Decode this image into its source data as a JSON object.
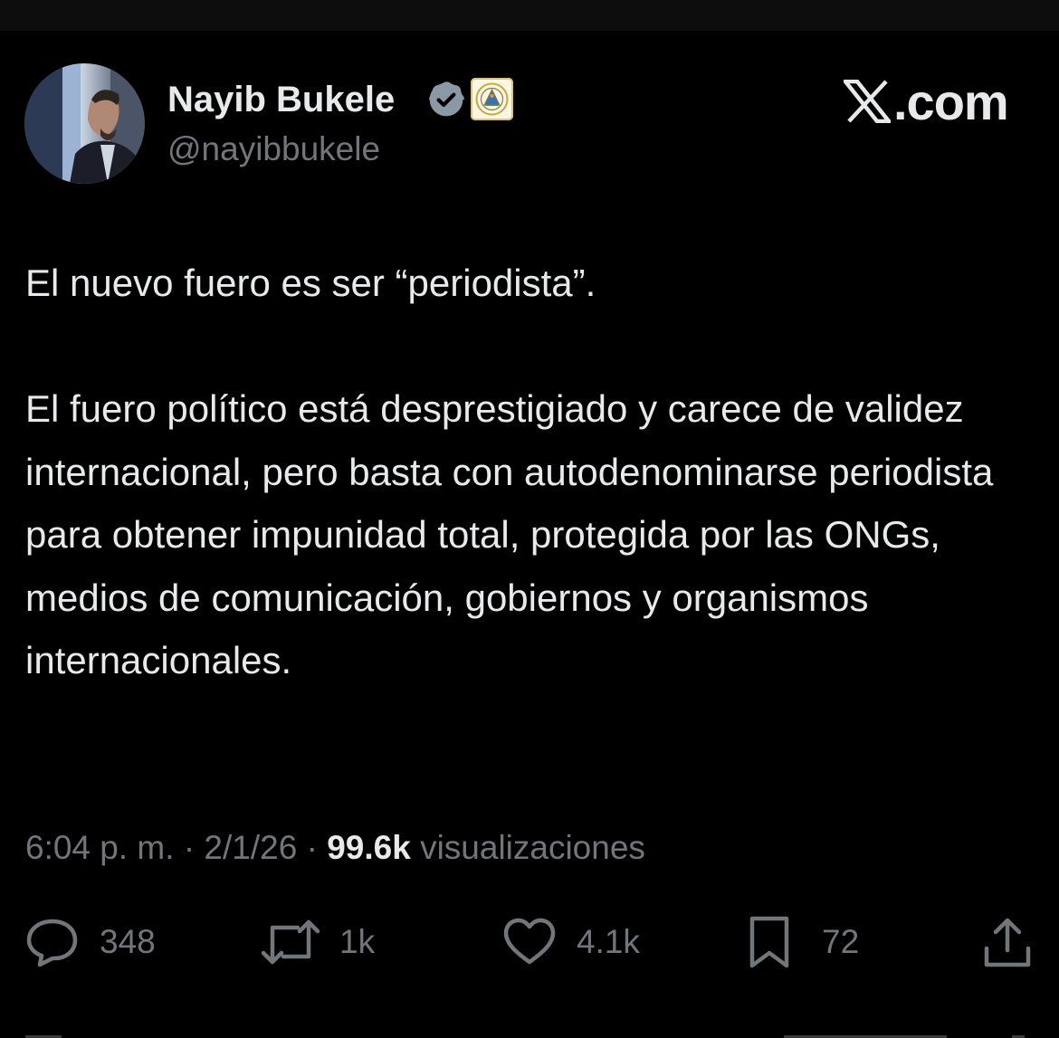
{
  "author": {
    "display_name": "Nayib Bukele",
    "handle": "@nayibbukele",
    "verified_icon": "verified-badge-icon",
    "affiliation_icon": "el-salvador-seal-icon"
  },
  "brand": {
    "site_label": ".com",
    "logo_icon": "x-logo-icon"
  },
  "tweet": {
    "paragraphs": [
      "El nuevo fuero es ser “periodista”.",
      "El fuero político está desprestigiado y carece de validez internacional, pero basta con autodenominarse periodista para obtener impunidad total, protegida por las ONGs, medios de comunicación, gobiernos y organismos internacionales."
    ]
  },
  "meta": {
    "time": "6:04 p. m.",
    "separator": "·",
    "date": "2/1/26",
    "views_count": "99.6k",
    "views_label": "visualizaciones"
  },
  "actions": {
    "replies": "348",
    "reposts": "1k",
    "likes": "4.1k",
    "bookmarks": "72"
  },
  "colors": {
    "background": "#000000",
    "text_primary": "#e7e9ea",
    "text_secondary": "#71767b",
    "verified_badge": "#8b98a5"
  }
}
